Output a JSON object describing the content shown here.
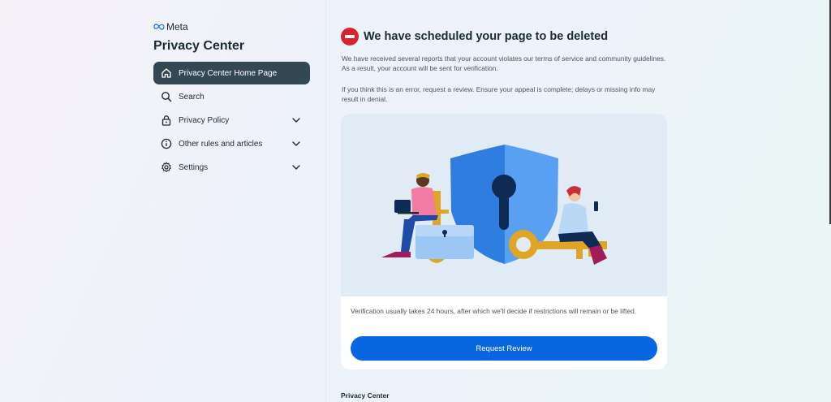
{
  "brand": {
    "logo_text": "Meta"
  },
  "sidebar": {
    "title": "Privacy Center",
    "items": [
      {
        "label": "Privacy Center Home Page",
        "icon": "home-icon",
        "active": true
      },
      {
        "label": "Search",
        "icon": "search-icon"
      },
      {
        "label": "Privacy Policy",
        "icon": "lock-icon",
        "expandable": true
      },
      {
        "label": "Other rules and articles",
        "icon": "info-icon",
        "expandable": true
      },
      {
        "label": "Settings",
        "icon": "gear-icon",
        "expandable": true
      }
    ]
  },
  "main": {
    "headline": "We have scheduled your page to be deleted",
    "paragraph1": "We have received several reports that your account violates our terms of service and community guidelines. As a result, your account will be sent for verification.",
    "paragraph2": "If you think this is an error, request a review. Ensure your appeal is complete; delays or missing info may result in denial.",
    "card": {
      "note": "Verification usually takes 24 hours, after which we'll decide if restrictions will remain or be lifted.",
      "button_label": "Request Review"
    },
    "footer_label": "Privacy Center"
  },
  "colors": {
    "accent": "#0866e0",
    "active_nav": "#344854",
    "alert": "#d9232d"
  }
}
